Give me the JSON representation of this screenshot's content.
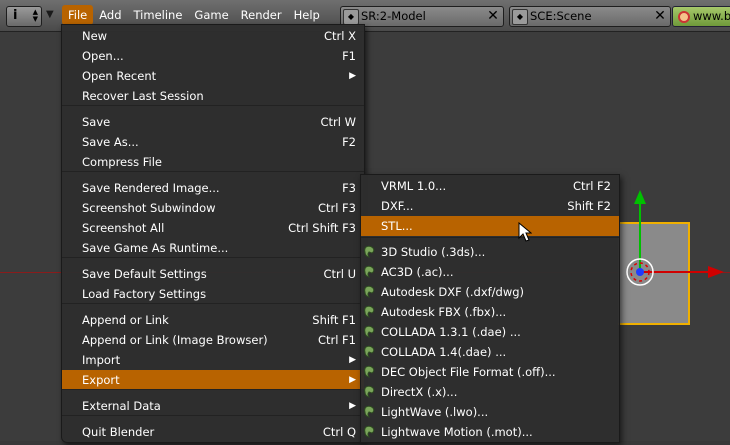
{
  "header": {
    "editor_type_glyph": "i",
    "menus": [
      "File",
      "Add",
      "Timeline",
      "Game",
      "Render",
      "Help"
    ],
    "active_menu": "File",
    "screen_field": "SR:2-Model",
    "scene_field": "SCE:Scene",
    "url_field": "www.b"
  },
  "file_menu": [
    {
      "label": "New",
      "shortcut": "Ctrl X"
    },
    {
      "label": "Open...",
      "shortcut": "F1"
    },
    {
      "label": "Open Recent",
      "shortcut": ""
    },
    {
      "label": "Recover Last Session",
      "shortcut": ""
    },
    {
      "label": "Save",
      "shortcut": "Ctrl W"
    },
    {
      "label": "Save As...",
      "shortcut": "F2"
    },
    {
      "label": "Compress File",
      "shortcut": ""
    },
    {
      "label": "Save Rendered Image...",
      "shortcut": "F3"
    },
    {
      "label": "Screenshot Subwindow",
      "shortcut": "Ctrl F3"
    },
    {
      "label": "Screenshot All",
      "shortcut": "Ctrl Shift F3"
    },
    {
      "label": "Save Game As Runtime...",
      "shortcut": ""
    },
    {
      "label": "Save Default Settings",
      "shortcut": "Ctrl U"
    },
    {
      "label": "Load Factory Settings",
      "shortcut": ""
    },
    {
      "label": "Append or Link",
      "shortcut": "Shift F1"
    },
    {
      "label": "Append or Link (Image Browser)",
      "shortcut": "Ctrl F1"
    },
    {
      "label": "Import",
      "shortcut": ""
    },
    {
      "label": "Export",
      "shortcut": ""
    },
    {
      "label": "External Data",
      "shortcut": ""
    },
    {
      "label": "Quit Blender",
      "shortcut": "Ctrl Q"
    }
  ],
  "export_menu": [
    {
      "label": "VRML 1.0...",
      "shortcut": "Ctrl F2"
    },
    {
      "label": "DXF...",
      "shortcut": "Shift F2"
    },
    {
      "label": "STL...",
      "shortcut": ""
    },
    {
      "label": "3D Studio (.3ds)...",
      "shortcut": ""
    },
    {
      "label": "AC3D (.ac)...",
      "shortcut": ""
    },
    {
      "label": "Autodesk DXF (.dxf/dwg)",
      "shortcut": ""
    },
    {
      "label": "Autodesk FBX (.fbx)...",
      "shortcut": ""
    },
    {
      "label": "COLLADA 1.3.1 (.dae) ...",
      "shortcut": ""
    },
    {
      "label": "COLLADA 1.4(.dae) ...",
      "shortcut": ""
    },
    {
      "label": "DEC Object File Format (.off)...",
      "shortcut": ""
    },
    {
      "label": "DirectX (.x)...",
      "shortcut": ""
    },
    {
      "label": "LightWave (.lwo)...",
      "shortcut": ""
    },
    {
      "label": "Lightwave Motion (.mot)...",
      "shortcut": ""
    }
  ],
  "colors": {
    "highlight": "#b86300",
    "menu_bg": "#2e2e2e",
    "selection": "#f0b000"
  }
}
